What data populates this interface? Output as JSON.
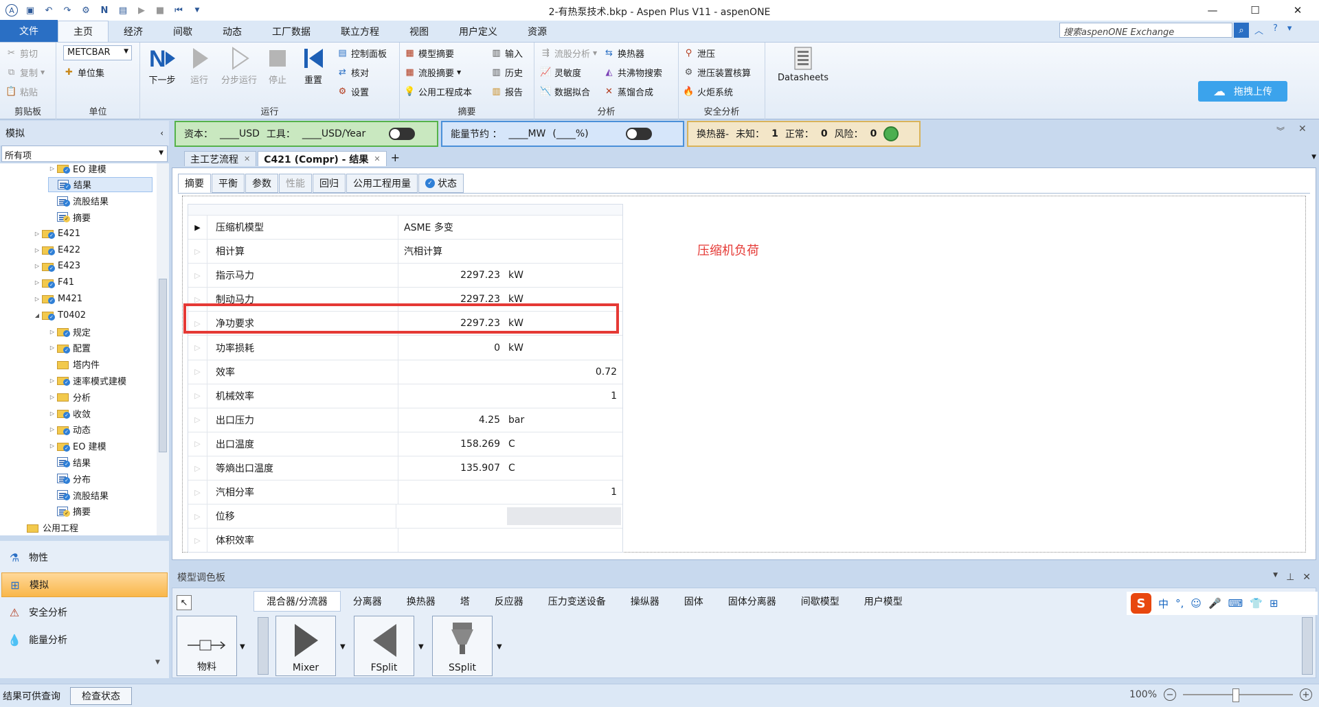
{
  "window": {
    "title": "2-有热泵技术.bkp - Aspen Plus V11 - aspenONE",
    "minimize": "—",
    "maximize": "☐",
    "close": "✕"
  },
  "ribbon_tabs": [
    "文件",
    "主页",
    "经济",
    "间歇",
    "动态",
    "工厂数据",
    "联立方程",
    "视图",
    "用户定义",
    "资源"
  ],
  "ribbon_search_placeholder": "搜索aspenONE Exchange",
  "clipboard": {
    "cut": "剪切",
    "copy": "复制",
    "paste": "粘贴",
    "label": "剪贴板"
  },
  "units": {
    "selected": "METCBAR",
    "unit_sets": "单位集",
    "label": "单位"
  },
  "run": {
    "next": "下一步",
    "run": "运行",
    "step": "分步运行",
    "stop": "停止",
    "reset": "重置",
    "control_panel": "控制面板",
    "check": "核对",
    "settings": "设置",
    "label": "运行"
  },
  "summary": {
    "model_summary": "模型摘要",
    "stream_summary": "流股摘要",
    "utility_cost": "公用工程成本",
    "input": "输入",
    "history": "历史",
    "report": "报告",
    "label": "摘要"
  },
  "analysis": {
    "stream_analysis": "流股分析",
    "heat_exchanger": "换热器",
    "sensitivity": "灵敏度",
    "azeotrope": "共沸物搜索",
    "data_fit": "数据拟合",
    "distillation": "蒸馏合成",
    "label": "分析"
  },
  "safety": {
    "relief": "泄压",
    "relief_rating": "泄压装置核算",
    "flare": "火炬系统",
    "label": "安全分析"
  },
  "datasheets": "Datasheets",
  "upload": "拖拽上传",
  "status_strip": {
    "capital_label": "资本：",
    "capital_value": "____USD",
    "utility_label": "工具：",
    "utility_value": "____USD/Year",
    "energy_label": "能量节约 ：",
    "energy_value": "____MW",
    "energy_pct": "(____%)",
    "hx_label": "换热器-",
    "unknown_label": "未知：",
    "unknown_value": "1",
    "normal_label": "正常：",
    "normal_value": "0",
    "risk_label": "风险：",
    "risk_value": "0"
  },
  "nav": {
    "header": "模拟",
    "filter": "所有项",
    "tree": [
      {
        "label": "EO 建模",
        "indent": 2,
        "icon": "folder-check",
        "arrow": "▷"
      },
      {
        "label": "结果",
        "indent": 2,
        "icon": "page-check",
        "arrow": "",
        "selected": true
      },
      {
        "label": "流股结果",
        "indent": 2,
        "icon": "page-check",
        "arrow": ""
      },
      {
        "label": "摘要",
        "indent": 2,
        "icon": "page-yellow-check",
        "arrow": ""
      },
      {
        "label": "E421",
        "indent": 1,
        "icon": "folder-check",
        "arrow": "▷"
      },
      {
        "label": "E422",
        "indent": 1,
        "icon": "folder-check",
        "arrow": "▷"
      },
      {
        "label": "E423",
        "indent": 1,
        "icon": "folder-check",
        "arrow": "▷"
      },
      {
        "label": "F41",
        "indent": 1,
        "icon": "folder-check",
        "arrow": "▷"
      },
      {
        "label": "M421",
        "indent": 1,
        "icon": "folder-check",
        "arrow": "▷"
      },
      {
        "label": "T0402",
        "indent": 1,
        "icon": "folder-check",
        "arrow": "◢"
      },
      {
        "label": "规定",
        "indent": 2,
        "icon": "folder-check",
        "arrow": "▷"
      },
      {
        "label": "配置",
        "indent": 2,
        "icon": "folder-check",
        "arrow": "▷"
      },
      {
        "label": "塔内件",
        "indent": 2,
        "icon": "folder",
        "arrow": ""
      },
      {
        "label": "速率模式建模",
        "indent": 2,
        "icon": "folder-check",
        "arrow": "▷"
      },
      {
        "label": "分析",
        "indent": 2,
        "icon": "folder",
        "arrow": "▷"
      },
      {
        "label": "收敛",
        "indent": 2,
        "icon": "folder-check",
        "arrow": "▷"
      },
      {
        "label": "动态",
        "indent": 2,
        "icon": "folder-check",
        "arrow": "▷"
      },
      {
        "label": "EO 建模",
        "indent": 2,
        "icon": "folder-check",
        "arrow": "▷"
      },
      {
        "label": "结果",
        "indent": 2,
        "icon": "page-check",
        "arrow": ""
      },
      {
        "label": "分布",
        "indent": 2,
        "icon": "page-check",
        "arrow": ""
      },
      {
        "label": "流股结果",
        "indent": 2,
        "icon": "page-check",
        "arrow": ""
      },
      {
        "label": "摘要",
        "indent": 2,
        "icon": "page-yellow-check",
        "arrow": ""
      },
      {
        "label": "公用工程",
        "indent": 0,
        "icon": "folder",
        "arrow": ""
      }
    ],
    "buttons": [
      "物性",
      "模拟",
      "安全分析",
      "能量分析"
    ]
  },
  "doc_tabs": [
    {
      "label": "主工艺流程",
      "active": false
    },
    {
      "label": "C421 (Compr) - 结果",
      "active": true
    }
  ],
  "sub_tabs": [
    "摘要",
    "平衡",
    "参数",
    "性能",
    "回归",
    "公用工程用量",
    "状态"
  ],
  "results": [
    {
      "label": "压缩机模型",
      "value": "ASME 多变",
      "unit": "",
      "value_align": "left"
    },
    {
      "label": "相计算",
      "value": "汽相计算",
      "unit": "",
      "value_align": "left"
    },
    {
      "label": "指示马力",
      "value": "2297.23",
      "unit": "kW"
    },
    {
      "label": "制动马力",
      "value": "2297.23",
      "unit": "kW"
    },
    {
      "label": "净功要求",
      "value": "2297.23",
      "unit": "kW"
    },
    {
      "label": "功率损耗",
      "value": "0",
      "unit": "kW"
    },
    {
      "label": "效率",
      "value": "",
      "unit": "0.72"
    },
    {
      "label": "机械效率",
      "value": "",
      "unit": "1"
    },
    {
      "label": "出口压力",
      "value": "4.25",
      "unit": "bar"
    },
    {
      "label": "出口温度",
      "value": "158.269",
      "unit": "C"
    },
    {
      "label": "等熵出口温度",
      "value": "135.907",
      "unit": "C"
    },
    {
      "label": "汽相分率",
      "value": "",
      "unit": "1"
    },
    {
      "label": "位移",
      "value": "",
      "unit": ""
    },
    {
      "label": "体积效率",
      "value": "",
      "unit": ""
    }
  ],
  "annotation": "压缩机负荷",
  "palette": {
    "header": "模型调色板",
    "categories": [
      "混合器/分流器",
      "分离器",
      "换热器",
      "塔",
      "反应器",
      "压力变送设备",
      "操纵器",
      "固体",
      "固体分离器",
      "间歇模型",
      "用户模型"
    ],
    "items": [
      "物料",
      "Mixer",
      "FSplit",
      "SSplit"
    ]
  },
  "ime": {
    "lang": "中",
    "punct": "°,"
  },
  "statusbar": {
    "text": "结果可供查询",
    "check_button": "检查状态",
    "zoom": "100%"
  },
  "colors": {
    "accent": "#2a6fc4",
    "highlight": "#e53935",
    "annotation": "#e53935",
    "active_nav": "#f9b74a",
    "capital_box": "#c9e8c0",
    "energy_box": "#d6e6fa",
    "hx_box": "#f3e6c8"
  }
}
